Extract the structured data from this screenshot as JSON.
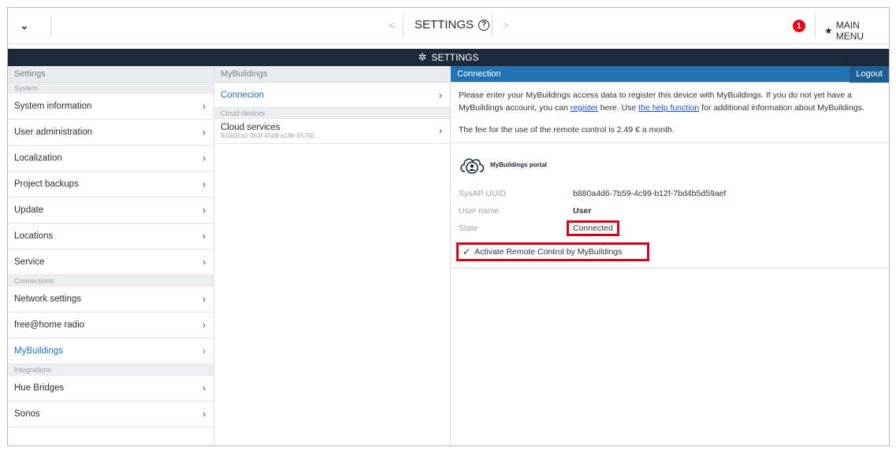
{
  "topbar": {
    "collapse_icon": "chevron-down-icon",
    "prev_glyph": "<",
    "title": "SETTINGS",
    "next_glyph": ">",
    "notification_count": "1",
    "main_menu_label": "MAIN MENU"
  },
  "header": {
    "title": "SETTINGS"
  },
  "sidebar": {
    "heading": "Settings",
    "groups": [
      {
        "label": "System",
        "items": [
          "System information",
          "User administration",
          "Localization",
          "Project backups",
          "Update",
          "Locations",
          "Service"
        ]
      },
      {
        "label": "Connections",
        "items": [
          "Network settings",
          "free@home radio",
          "MyBuildings"
        ]
      },
      {
        "label": "Integrations",
        "items": [
          "Hue Bridges",
          "Sonos"
        ]
      }
    ],
    "active_item": "MyBuildings"
  },
  "middle": {
    "heading": "MyBuildings",
    "connection_label": "Connecion",
    "cloud_group_label": "Cloud devices",
    "cloud_service_title": "Cloud services",
    "cloud_service_id": "8c0d2ca1-363f-45d8-a18b-55750..."
  },
  "detail": {
    "heading": "Connection",
    "logout_label": "Logout",
    "intro_part1": "Please enter your MyBuildings access data to register this device with MyBuildings. If you do not yet have a MyBuildings account, you can ",
    "register_link": "register",
    "intro_part2": " here. Use ",
    "help_link": "the help function",
    "intro_part3": " for additional information about MyBuildings.",
    "fee_text": "The fee for the use of the remote control is 2.49 € a month.",
    "portal_name": "MyBuildings portal",
    "uuid_label": "SysAP UUID",
    "uuid_value": "b880a4d6-7b59-4c99-b12f-7bd4b5d59aef",
    "user_label": "User name",
    "user_value": "User",
    "state_label": "State",
    "state_value": "Connected",
    "checkbox_label": "Activate Remote Control by MyBuildings",
    "checkbox_checked": true
  },
  "colors": {
    "header_dark": "#1e2a3a",
    "accent_blue": "#2273b3",
    "highlight_red": "#d0001b",
    "badge_red": "#e30613"
  }
}
